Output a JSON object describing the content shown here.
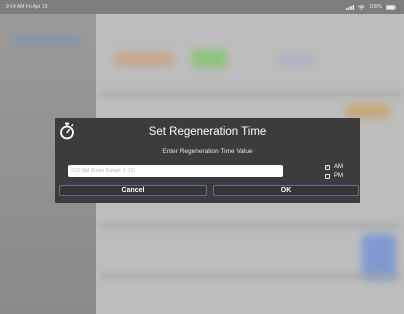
{
  "status_bar": {
    "time_date": "9:14 AM  Fri Apr 19",
    "battery": "100%"
  },
  "dialog": {
    "icon": "timer-icon",
    "title": "Set Regeneration Time",
    "subtitle": "Enter Regeneration Time Value",
    "input_placeholder": "2:02 AM (Enter Range: 1-12)",
    "options": [
      {
        "label": "AM",
        "checked": true
      },
      {
        "label": "PM",
        "checked": false
      }
    ],
    "cancel_label": "Cancel",
    "ok_label": "OK",
    "accent_color": "#5b6f9c"
  }
}
